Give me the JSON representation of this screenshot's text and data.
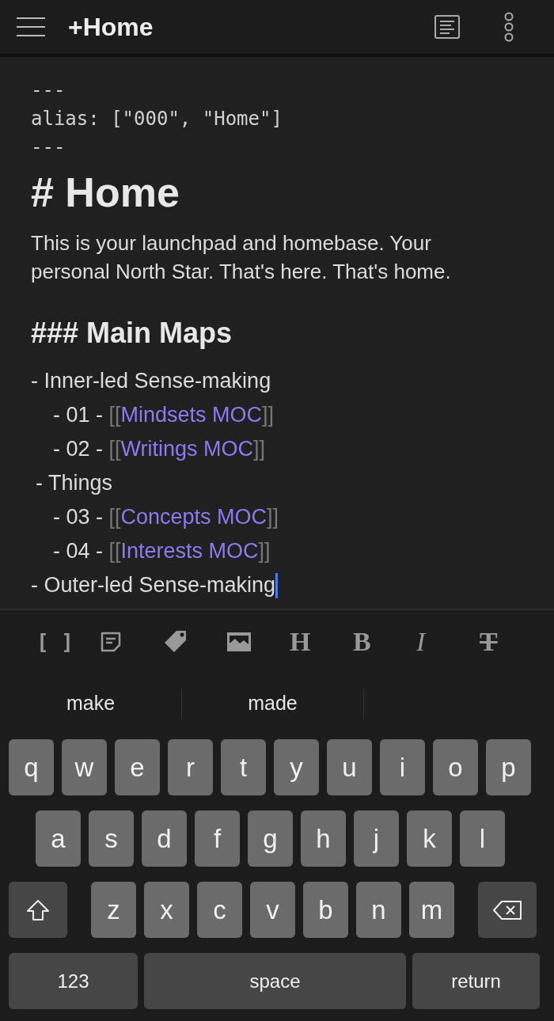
{
  "header": {
    "title": "+Home"
  },
  "editor": {
    "frontmatter": [
      "---",
      "alias: [\"000\", \"Home\"]",
      "---"
    ],
    "heading": "# Home",
    "paragraph": "This is your launchpad and homebase. Your personal North Star. That's here. That's home.",
    "subheading": "### Main Maps",
    "list": [
      {
        "text": "- Inner-led Sense-making",
        "cursor": false,
        "children": [
          {
            "prefix": "- 01 - ",
            "open": "[[",
            "link": "Mindsets MOC",
            "close": "]]"
          },
          {
            "prefix": "- 02 - ",
            "open": "[[",
            "link": "Writings MOC",
            "close": "]]"
          }
        ]
      },
      {
        "text": "- Things",
        "cursor": false,
        "children": [
          {
            "prefix": "- 03 - ",
            "open": "[[",
            "link": "Concepts MOC",
            "close": "]]"
          },
          {
            "prefix": "- 04 - ",
            "open": "[[",
            "link": "Interests MOC",
            "close": "]]"
          }
        ]
      },
      {
        "text": "- Outer-led Sense-making",
        "cursor": true
      }
    ]
  },
  "toolbar": [
    {
      "kind": "brackets",
      "label": "[ ]"
    },
    {
      "kind": "note"
    },
    {
      "kind": "tag"
    },
    {
      "kind": "image"
    },
    {
      "kind": "heading",
      "label": "H"
    },
    {
      "kind": "bold",
      "label": "B"
    },
    {
      "kind": "italic",
      "label": "I"
    },
    {
      "kind": "strike",
      "label": "T"
    }
  ],
  "suggestions": [
    "make",
    "made"
  ],
  "keyboard": [
    {
      "keys": [
        {
          "label": "q"
        },
        {
          "label": "w"
        },
        {
          "label": "e"
        },
        {
          "label": "r"
        },
        {
          "label": "t"
        },
        {
          "label": "y"
        },
        {
          "label": "u"
        },
        {
          "label": "i"
        },
        {
          "label": "o"
        },
        {
          "label": "p"
        }
      ]
    },
    {
      "keys": [
        {
          "label": "a"
        },
        {
          "label": "s"
        },
        {
          "label": "d"
        },
        {
          "label": "f"
        },
        {
          "label": "g"
        },
        {
          "label": "h"
        },
        {
          "label": "j"
        },
        {
          "label": "k"
        },
        {
          "label": "l"
        }
      ]
    },
    {
      "keys": [
        {
          "kind": "shift"
        },
        {
          "label": "z"
        },
        {
          "label": "x"
        },
        {
          "label": "c"
        },
        {
          "label": "v"
        },
        {
          "label": "b"
        },
        {
          "label": "n"
        },
        {
          "label": "m"
        },
        {
          "kind": "delete"
        }
      ]
    },
    {
      "keys": [
        {
          "kind": "numbers",
          "label": "123"
        },
        {
          "kind": "space",
          "label": "space"
        },
        {
          "kind": "return",
          "label": "return"
        }
      ]
    }
  ]
}
